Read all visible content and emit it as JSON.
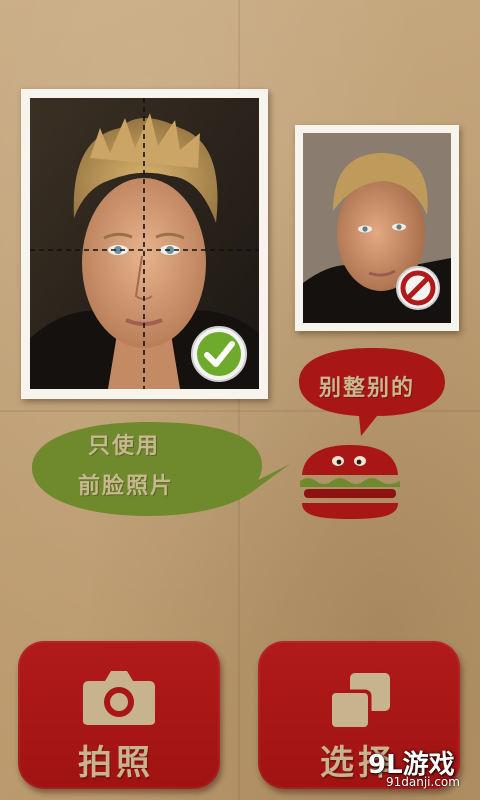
{
  "bubbles": {
    "left_line1": "只使用",
    "left_line2": "前脸照片",
    "right": "别整别的"
  },
  "buttons": {
    "camera_label": "拍照",
    "gallery_label": "选择"
  },
  "icons": {
    "check": "check-icon",
    "forbidden": "forbidden-icon",
    "burger": "burger-mascot-icon",
    "camera": "camera-icon",
    "gallery": "gallery-icon"
  },
  "colors": {
    "brand_red": "#a81616",
    "bubble_green": "#6f8a2c",
    "paper": "#c2a479",
    "label_tan": "#c9b78f"
  },
  "watermark": {
    "brand": "9L游戏",
    "url": "91danji.com"
  }
}
